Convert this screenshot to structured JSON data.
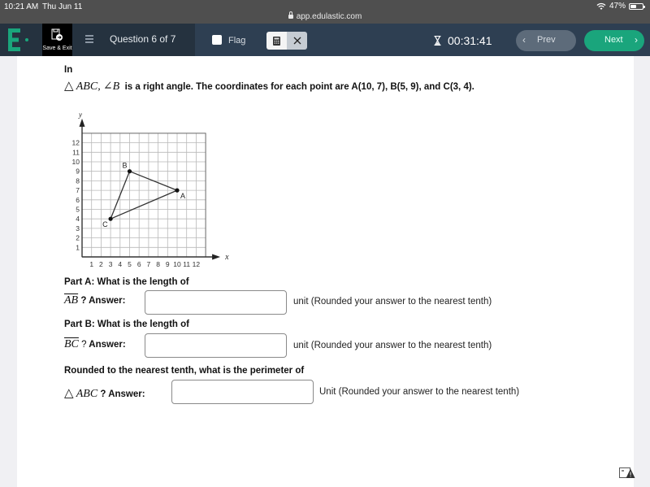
{
  "status_bar": {
    "time": "10:21 AM",
    "date": "Thu Jun 11",
    "url": "app.edulastic.com",
    "battery": "47%",
    "battery_level": 0.47
  },
  "toolbar": {
    "logo_letter": "E",
    "save_exit_label": "Save & Exit",
    "question_counter": "Question 6 of 7",
    "flag_label": "Flag",
    "flag_checked": false,
    "timer": "00:31:41",
    "prev_label": "Prev",
    "next_label": "Next",
    "colors": {
      "brand_green": "#1aa57c",
      "nav_bg": "#2e3f52"
    }
  },
  "question": {
    "intro": "In",
    "triangle_name": "ABC,",
    "angle_name": "∠B",
    "statement": "is a right angle. The coordinates for each point are A(10, 7), B(5, 9), and C(3, 4).",
    "triangle_symbol": "△"
  },
  "chart_data": {
    "type": "scatter",
    "title": "",
    "xlabel": "x",
    "ylabel": "y",
    "xlim": [
      0,
      13
    ],
    "ylim": [
      0,
      13
    ],
    "grid": true,
    "x_ticks": [
      "1",
      "2",
      "3",
      "4",
      "5",
      "6",
      "7",
      "8",
      "9",
      "10",
      "11",
      "12"
    ],
    "y_ticks": [
      "1",
      "2",
      "3",
      "4",
      "5",
      "6",
      "7",
      "8",
      "9",
      "10",
      "11",
      "12"
    ],
    "points": [
      {
        "label": "A",
        "x": 10,
        "y": 7
      },
      {
        "label": "B",
        "x": 5,
        "y": 9
      },
      {
        "label": "C",
        "x": 3,
        "y": 4
      }
    ],
    "segments": [
      [
        "A",
        "B"
      ],
      [
        "B",
        "C"
      ],
      [
        "C",
        "A"
      ]
    ]
  },
  "parts": [
    {
      "prompt": "Part A: What is the length of",
      "segment": "AB",
      "answer_label": "? Answer:",
      "answer_value": "",
      "unit_note": "unit  (Rounded your answer to the nearest tenth)"
    },
    {
      "prompt": "Part B: What is the length of",
      "segment": "BC",
      "answer_label": "? Answer:",
      "answer_value": "",
      "unit_note": "unit (Rounded your answer to the nearest tenth)"
    },
    {
      "prompt": "Rounded to the nearest tenth, what is the perimeter of",
      "segment": "ABC",
      "answer_label": "? Answer:",
      "answer_value": "",
      "unit_note": "Unit (Rounded your answer to the nearest tenth)"
    }
  ],
  "footer": {
    "warning_icon": "image-warning-icon"
  }
}
